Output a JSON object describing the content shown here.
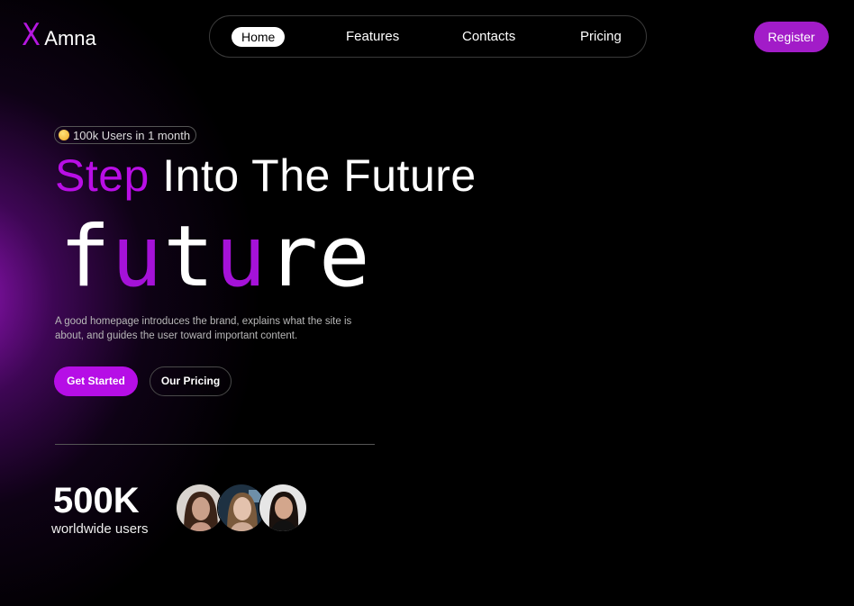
{
  "logo": {
    "mark": "X",
    "text": "Amna"
  },
  "nav": {
    "items": [
      {
        "label": "Home",
        "active": true
      },
      {
        "label": "Features",
        "active": false
      },
      {
        "label": "Contacts",
        "active": false
      },
      {
        "label": "Pricing",
        "active": false
      }
    ],
    "register_label": "Register"
  },
  "hero": {
    "badge": {
      "icon": "smiling-face-emoji-icon",
      "text": "100k Users in 1 month"
    },
    "headline_accent": "Step",
    "headline_rest": "Into The Future",
    "big_word": [
      "f",
      "u",
      "t",
      "u",
      "r",
      "e"
    ],
    "description": "A good homepage introduces the brand, explains what the site is about, and guides the user toward important content.",
    "primary_button": "Get Started",
    "secondary_button": "Our Pricing"
  },
  "stats": {
    "value": "500K",
    "label": "worldwide users"
  },
  "colors": {
    "accent": "#b90ee6",
    "button_purple": "#a21cc8",
    "background": "#000000"
  }
}
